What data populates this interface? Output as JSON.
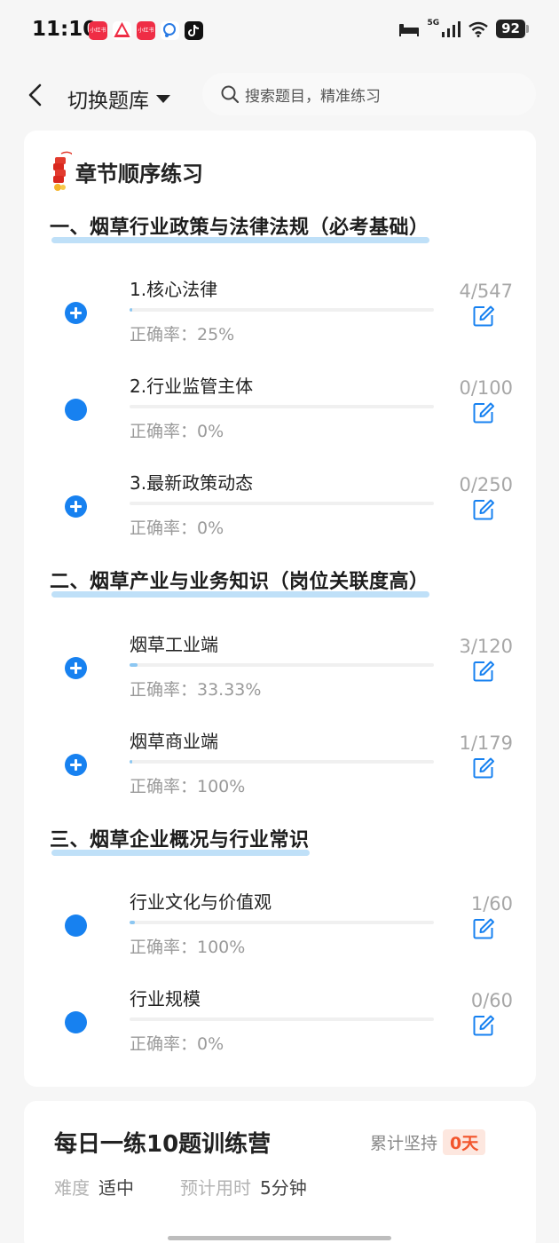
{
  "status": {
    "time": "11:10",
    "network": "5G",
    "battery": "92",
    "app_icons": [
      "xiaohongshu-icon",
      "app-triangle-icon",
      "xiaohongshu-icon",
      "chat-icon",
      "tiktok-icon"
    ]
  },
  "header": {
    "switch_label": "切换题库",
    "search_placeholder": "搜索题目，精准练习"
  },
  "practice": {
    "title": "章节顺序练习",
    "sections": [
      {
        "title": "一、烟草行业政策与法律法规（必考基础）",
        "items": [
          {
            "name": "1.核心法律",
            "accuracy": "正确率：25%",
            "count": "4/547",
            "expandable": true,
            "progress": 0.0073
          },
          {
            "name": "2.行业监管主体",
            "accuracy": "正确率：0%",
            "count": "0/100",
            "expandable": false,
            "progress": 0
          },
          {
            "name": "3.最新政策动态",
            "accuracy": "正确率：0%",
            "count": "0/250",
            "expandable": true,
            "progress": 0
          }
        ]
      },
      {
        "title": "二、烟草产业与业务知识（岗位关联度高）",
        "items": [
          {
            "name": "烟草工业端",
            "accuracy": "正确率：33.33%",
            "count": "3/120",
            "expandable": true,
            "progress": 0.025
          },
          {
            "name": "烟草商业端",
            "accuracy": "正确率：100%",
            "count": "1/179",
            "expandable": true,
            "progress": 0.0056
          }
        ]
      },
      {
        "title": "三、烟草企业概况与行业常识",
        "items": [
          {
            "name": "行业文化与价值观",
            "accuracy": "正确率：100%",
            "count": "1/60",
            "expandable": false,
            "progress": 0.0167
          },
          {
            "name": "行业规模",
            "accuracy": "正确率：0%",
            "count": "0/60",
            "expandable": false,
            "progress": 0
          }
        ]
      }
    ]
  },
  "camp": {
    "title": "每日一练10题训练营",
    "keep_label": "累计坚持",
    "days": "0天",
    "difficulty_label": "难度",
    "difficulty_value": "适中",
    "time_label": "预计用时",
    "time_value": "5分钟"
  },
  "colors": {
    "accent": "#1781f0",
    "highlight": "#bfe0f8",
    "days_bg": "#fde7df",
    "days_text": "#f2552c"
  }
}
